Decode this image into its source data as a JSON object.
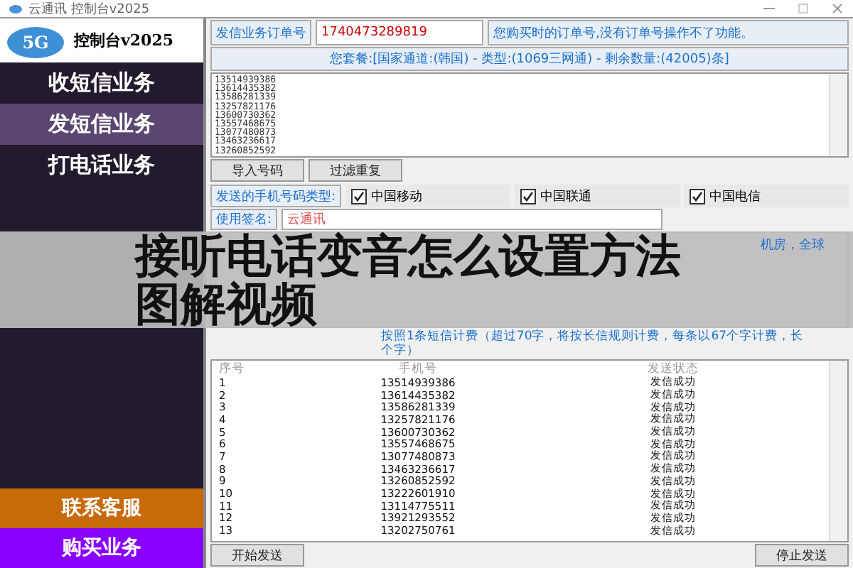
{
  "window": {
    "title": "云通讯 控制台v2025"
  },
  "sidebar": {
    "logo_text": "控制台v2025",
    "logo_badge": "5G",
    "menu": [
      {
        "label": "收短信业务",
        "selected": false
      },
      {
        "label": "发短信业务",
        "selected": true
      },
      {
        "label": "打电话业务",
        "selected": false
      }
    ],
    "actions": [
      {
        "label": "联系客服",
        "color": "#c8690a"
      },
      {
        "label": "购买业务",
        "color": "#8a00ff"
      }
    ]
  },
  "order": {
    "label": "发信业务订单号",
    "value": "1740473289819",
    "hint": "您购买时的订单号,没有订单号操作不了功能。"
  },
  "package_info": "您套餐:[国家通道:(韩国) - 类型:(1069三网通) - 剩余数量:(42005)条]",
  "numbers": [
    "13514939386",
    "13614435382",
    "13586281339",
    "13257821176",
    "13600730362",
    "13557468675",
    "13077480873",
    "13463236617",
    "13260852592"
  ],
  "buttons": [
    "导入号码",
    "过滤重复"
  ],
  "carrier_types": {
    "label": "发送的手机号码类型:",
    "items": [
      {
        "label": "中国移动",
        "checked": true
      },
      {
        "label": "中国联通",
        "checked": true
      },
      {
        "label": "中国电信",
        "checked": true
      }
    ]
  },
  "signature": {
    "label": "使用签名:",
    "value": "云通讯"
  },
  "content_partial": "机房，全球",
  "note_lines": [
    "按照1条短信计费（超过70字，将按长信规则计费，每条以67个字计费，长",
    "个字）"
  ],
  "table": {
    "columns": [
      "序号",
      "手机号",
      "发送状态"
    ],
    "rows": [
      [
        "1",
        "13514939386",
        "发信成功"
      ],
      [
        "2",
        "13614435382",
        "发信成功"
      ],
      [
        "3",
        "13586281339",
        "发信成功"
      ],
      [
        "4",
        "13257821176",
        "发信成功"
      ],
      [
        "5",
        "13600730362",
        "发信成功"
      ],
      [
        "6",
        "13557468675",
        "发信成功"
      ],
      [
        "7",
        "13077480873",
        "发信成功"
      ],
      [
        "8",
        "13463236617",
        "发信成功"
      ],
      [
        "9",
        "13260852592",
        "发信成功"
      ],
      [
        "10",
        "13222601910",
        "发信成功"
      ],
      [
        "11",
        "13114775511",
        "发信成功"
      ],
      [
        "12",
        "13921293552",
        "发信成功"
      ],
      [
        "13",
        "13202750761",
        "发信成功"
      ]
    ]
  },
  "footer_buttons": [
    "开始发送",
    "停止发送"
  ],
  "overlay_title": [
    "接听电话变音怎么设置方法",
    "图解视频"
  ]
}
